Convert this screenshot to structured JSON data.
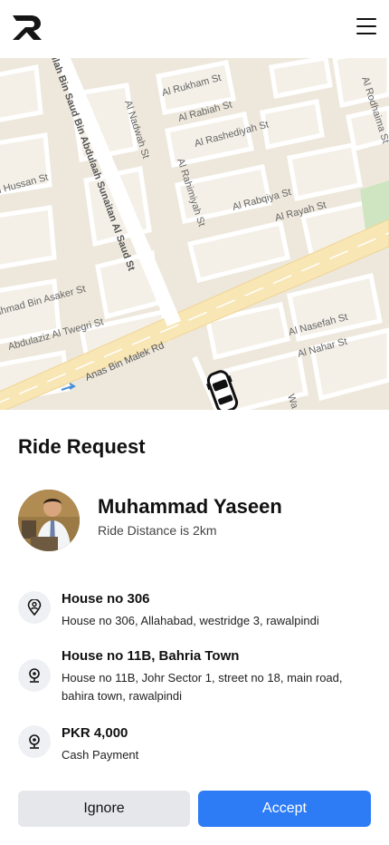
{
  "map": {
    "streets": [
      "Al Rukham St",
      "Al Rabiah St",
      "Al Rashediyah St",
      "Al Nadwah St",
      "Al Rahimiyah St",
      "Al Rabqiya St",
      "Al Rayah St",
      "Al Rodhaima St",
      "n Hussan St",
      "ahmad Bin Asaker St",
      "Abdulaziz Al Twegri St",
      "Anas Bin Malek Rd",
      "Al Nasefah St",
      "Al Nahar St",
      "llah Bin Saud Bin Abdulaah Sunaitan Al Saud St",
      "Wa"
    ]
  },
  "request": {
    "title": "Ride Request"
  },
  "rider": {
    "name": "Muhammad Yaseen",
    "distance_text": "Ride Distance is 2km"
  },
  "stops": [
    {
      "title": "House no 306",
      "detail": "House no 306, Allahabad, westridge 3, rawalpindi"
    },
    {
      "title": "House no 11B, Bahria Town",
      "detail": "House no 11B, Johr Sector 1, street no 18, main road, bahira town, rawalpindi"
    },
    {
      "title": "PKR 4,000",
      "detail": "Cash Payment"
    }
  ],
  "actions": {
    "ignore": "Ignore",
    "accept": "Accept"
  },
  "colors": {
    "accent": "#2d7cf6",
    "secondary_button": "#e5e7eb",
    "map_background": "#eee8dc",
    "main_road": "#f8e6b5"
  }
}
